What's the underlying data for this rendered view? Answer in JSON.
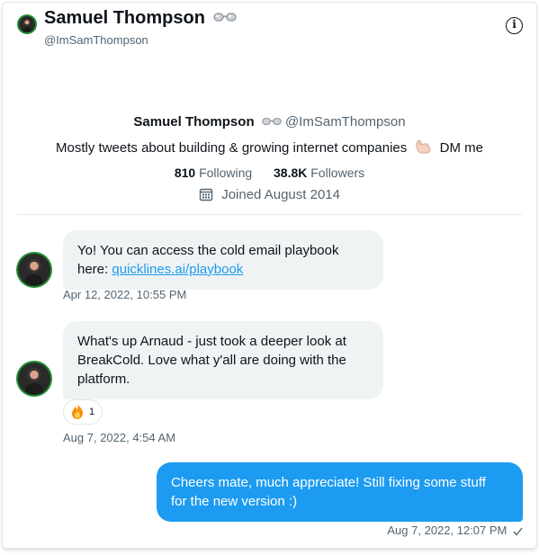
{
  "header": {
    "name": "Samuel Thompson",
    "handle": "@ImSamThompson",
    "name_emoji_icon": "goggles-icon",
    "info_icon": "info-icon"
  },
  "profile": {
    "name": "Samuel Thompson",
    "handle": "@ImSamThompson",
    "bio_before": "Mostly tweets about building & growing internet companies",
    "bio_after": "DM me",
    "bio_emoji_icon": "call-me-hand-icon",
    "following_count": "810",
    "following_label": "Following",
    "followers_count": "38.8K",
    "followers_label": "Followers",
    "joined": "Joined August 2014"
  },
  "messages": [
    {
      "direction": "incoming",
      "text_line1": "Yo! You can access the cold email playbook",
      "text_prefix": "here: ",
      "link": "quicklines.ai/playbook",
      "timestamp": "Apr 12, 2022, 10:55 PM"
    },
    {
      "direction": "incoming",
      "text_line1": "What's up Arnaud - just took a deeper look at",
      "text_line2": "BreakCold. Love what y'all are doing with the",
      "text_line3": "platform.",
      "reaction_emoji_icon": "fire-icon",
      "reaction_count": "1",
      "timestamp": "Aug 7, 2022, 4:54 AM"
    },
    {
      "direction": "outgoing",
      "text_line1": "Cheers mate, much appreciate! Still fixing some stuff",
      "text_line2": "for the new version :)",
      "timestamp": "Aug 7, 2022, 12:07 PM",
      "status_icon": "checkmark-icon"
    }
  ],
  "colors": {
    "accent": "#1d9bf0",
    "text": "#0f1419",
    "muted": "#536471",
    "bubble_in": "#eff3f4",
    "avatar_ring": "#1f8c32"
  }
}
